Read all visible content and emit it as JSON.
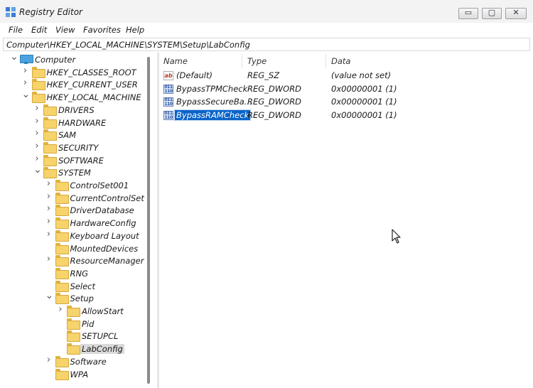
{
  "window": {
    "title": "Registry Editor",
    "controls": {
      "minimize": "▭",
      "maximize": "▢",
      "close": "✕"
    }
  },
  "menu": [
    "File",
    "Edit",
    "View",
    "Favorites",
    "Help"
  ],
  "address": "Computer\\HKEY_LOCAL_MACHINE\\SYSTEM\\Setup\\LabConfig",
  "tree": [
    {
      "label": "Computer",
      "depth": 0,
      "expander": "expanded",
      "icon": "computer-icon"
    },
    {
      "label": "HKEY_CLASSES_ROOT",
      "depth": 1,
      "expander": "collapsed",
      "icon": "folder-icon"
    },
    {
      "label": "HKEY_CURRENT_USER",
      "depth": 1,
      "expander": "collapsed",
      "icon": "folder-icon"
    },
    {
      "label": "HKEY_LOCAL_MACHINE",
      "depth": 1,
      "expander": "expanded",
      "icon": "folder-icon"
    },
    {
      "label": "DRIVERS",
      "depth": 2,
      "expander": "collapsed",
      "icon": "folder-icon"
    },
    {
      "label": "HARDWARE",
      "depth": 2,
      "expander": "collapsed",
      "icon": "folder-icon"
    },
    {
      "label": "SAM",
      "depth": 2,
      "expander": "collapsed",
      "icon": "folder-icon"
    },
    {
      "label": "SECURITY",
      "depth": 2,
      "expander": "collapsed",
      "icon": "folder-icon"
    },
    {
      "label": "SOFTWARE",
      "depth": 2,
      "expander": "collapsed",
      "icon": "folder-icon"
    },
    {
      "label": "SYSTEM",
      "depth": 2,
      "expander": "expanded",
      "icon": "folder-icon"
    },
    {
      "label": "ControlSet001",
      "depth": 3,
      "expander": "collapsed",
      "icon": "folder-icon"
    },
    {
      "label": "CurrentControlSet",
      "depth": 3,
      "expander": "collapsed",
      "icon": "folder-icon"
    },
    {
      "label": "DriverDatabase",
      "depth": 3,
      "expander": "collapsed",
      "icon": "folder-icon"
    },
    {
      "label": "HardwareConfig",
      "depth": 3,
      "expander": "collapsed",
      "icon": "folder-icon"
    },
    {
      "label": "Keyboard Layout",
      "depth": 3,
      "expander": "collapsed",
      "icon": "folder-icon"
    },
    {
      "label": "MountedDevices",
      "depth": 3,
      "expander": "none",
      "icon": "folder-icon"
    },
    {
      "label": "ResourceManager",
      "depth": 3,
      "expander": "collapsed",
      "icon": "folder-icon"
    },
    {
      "label": "RNG",
      "depth": 3,
      "expander": "none",
      "icon": "folder-icon"
    },
    {
      "label": "Select",
      "depth": 3,
      "expander": "none",
      "icon": "folder-icon"
    },
    {
      "label": "Setup",
      "depth": 3,
      "expander": "expanded",
      "icon": "folder-icon"
    },
    {
      "label": "AllowStart",
      "depth": 4,
      "expander": "collapsed",
      "icon": "folder-icon"
    },
    {
      "label": "Pid",
      "depth": 4,
      "expander": "none",
      "icon": "folder-icon"
    },
    {
      "label": "SETUPCL",
      "depth": 4,
      "expander": "none",
      "icon": "folder-icon"
    },
    {
      "label": "LabConfig",
      "depth": 4,
      "expander": "none",
      "icon": "folder-icon",
      "selected": true
    },
    {
      "label": "Software",
      "depth": 3,
      "expander": "collapsed",
      "icon": "folder-icon"
    },
    {
      "label": "WPA",
      "depth": 3,
      "expander": "none",
      "icon": "folder-icon"
    }
  ],
  "values": {
    "columns": [
      "Name",
      "Type",
      "Data"
    ],
    "rows": [
      {
        "name": "(Default)",
        "type": "REG_SZ",
        "data": "(value not set)",
        "icon": "string-value-icon",
        "icon_text": "ab"
      },
      {
        "name": "BypassTPMCheck",
        "type": "REG_DWORD",
        "data": "0x00000001 (1)",
        "icon": "binary-value-icon",
        "icon_text": "011 110"
      },
      {
        "name": "BypassSecureBa...",
        "type": "REG_DWORD",
        "data": "0x00000001 (1)",
        "icon": "binary-value-icon",
        "icon_text": "011 110"
      },
      {
        "name": "BypassRAMCheck",
        "type": "REG_DWORD",
        "data": "0x00000001 (1)",
        "icon": "binary-value-icon",
        "icon_text": "011 110",
        "selected": true
      }
    ]
  },
  "colors": {
    "selection": "#0a64c8",
    "folder": "#f6d36b",
    "tree_selection": "#dadada"
  }
}
